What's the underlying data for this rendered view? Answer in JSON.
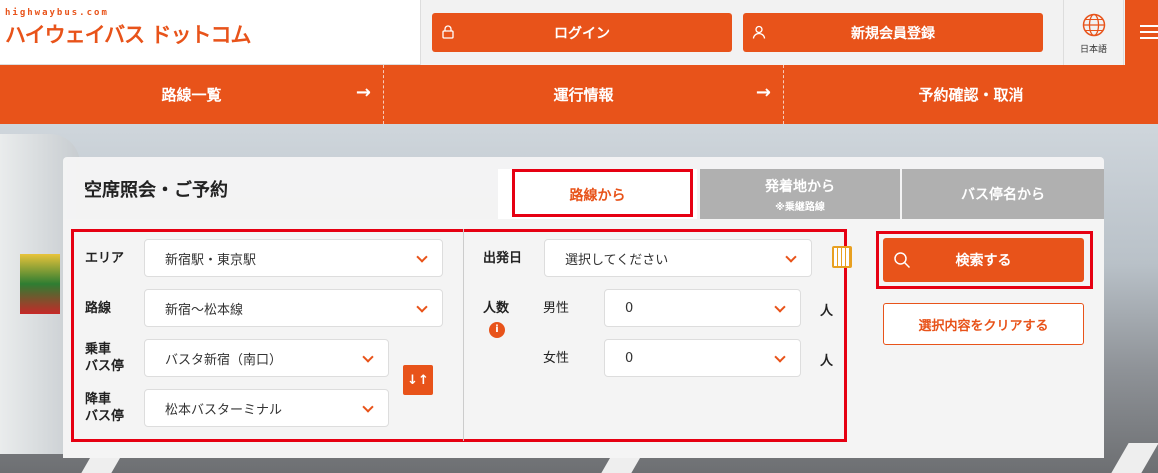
{
  "header": {
    "logo_small": "highwaybus.com",
    "logo_main": "ハイウェイバス ドットコム",
    "login_label": "ログイン",
    "register_label": "新規会員登録",
    "language_label": "日本語"
  },
  "nav": {
    "items": [
      {
        "label": "路線一覧",
        "arrow": "→"
      },
      {
        "label": "運行情報",
        "arrow": "→"
      },
      {
        "label": "予約確認・取消"
      }
    ]
  },
  "panel": {
    "title": "空席照会・ご予約",
    "tabs": [
      {
        "label": "路線から",
        "active": true
      },
      {
        "label": "発着地から",
        "sub": "※乗継路線"
      },
      {
        "label": "バス停名から"
      }
    ]
  },
  "form": {
    "area_label": "エリア",
    "area_value": "新宿駅・東京駅",
    "route_label": "路線",
    "route_value": "新宿〜松本線",
    "boarding_label_1": "乗車",
    "boarding_label_2": "バス停",
    "boarding_value": "バスタ新宿（南口）",
    "alighting_label_1": "降車",
    "alighting_label_2": "バス停",
    "alighting_value": "松本バスターミナル",
    "swap_symbol": "↓↑",
    "date_label": "出発日",
    "date_placeholder": "選択してください",
    "people_label": "人数",
    "info_symbol": "i",
    "male_label": "男性",
    "male_value": "0",
    "female_label": "女性",
    "female_value": "0",
    "unit_person": "人"
  },
  "actions": {
    "search_label": "検索する",
    "clear_label": "選択内容をクリアする"
  },
  "colors": {
    "brand": "#e8531a",
    "highlight": "#e60012"
  }
}
